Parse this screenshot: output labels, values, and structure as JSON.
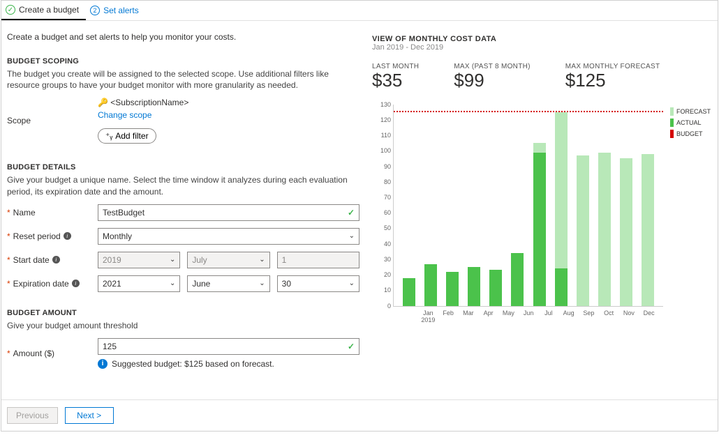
{
  "tabs": {
    "create": "Create a budget",
    "alerts": "Set alerts",
    "alerts_num": "2"
  },
  "intro": "Create a budget and set alerts to help you monitor your costs.",
  "scoping": {
    "title": "BUDGET SCOPING",
    "desc": "The budget you create will be assigned to the selected scope. Use additional filters like resource groups to have your budget monitor with more granularity as needed.",
    "scope_label": "Scope",
    "scope_value": "<SubscriptionName>",
    "change_scope": "Change scope",
    "add_filter": "Add filter"
  },
  "details": {
    "title": "BUDGET DETAILS",
    "desc": "Give your budget a unique name. Select the time window it analyzes during each evaluation period, its expiration date and the amount.",
    "name_label": "Name",
    "name_value": "TestBudget",
    "reset_label": "Reset period",
    "reset_value": "Monthly",
    "start_label": "Start date",
    "start_year": "2019",
    "start_month": "July",
    "start_day": "1",
    "exp_label": "Expiration date",
    "exp_year": "2021",
    "exp_month": "June",
    "exp_day": "30"
  },
  "amount": {
    "title": "BUDGET AMOUNT",
    "desc": "Give your budget amount threshold",
    "label": "Amount ($)",
    "value": "125",
    "suggest": "Suggested budget: $125 based on forecast."
  },
  "footer": {
    "prev": "Previous",
    "next": "Next >"
  },
  "view": {
    "title": "VIEW OF MONTHLY COST DATA",
    "range": "Jan 2019 - Dec 2019",
    "last_label": "LAST MONTH",
    "last_val": "$35",
    "max_label": "MAX (PAST 8 MONTH)",
    "max_val": "$99",
    "fc_label": "MAX MONTHLY FORECAST",
    "fc_val": "$125"
  },
  "legend": {
    "forecast": "FORECAST",
    "actual": "ACTUAL",
    "budget": "BUDGET"
  },
  "chart_data": {
    "type": "bar",
    "ylim": [
      0,
      130
    ],
    "y_ticks": [
      0,
      10,
      20,
      30,
      40,
      50,
      60,
      70,
      80,
      90,
      100,
      110,
      120,
      130
    ],
    "budget_line": 125,
    "categories": [
      "Jan 2019",
      "Feb",
      "Mar",
      "Apr",
      "May",
      "Jun",
      "Jul",
      "Aug",
      "Sep",
      "Oct",
      "Nov",
      "Dec"
    ],
    "series": [
      {
        "name": "forecast",
        "color": "#b8e8b8",
        "values": [
          0,
          0,
          0,
          0,
          0,
          0,
          105,
          125,
          97,
          99,
          95,
          98
        ]
      },
      {
        "name": "actual",
        "color": "#4bc24b",
        "values": [
          18,
          27,
          22,
          25,
          23,
          34,
          99,
          24,
          0,
          0,
          0,
          0
        ]
      }
    ]
  }
}
